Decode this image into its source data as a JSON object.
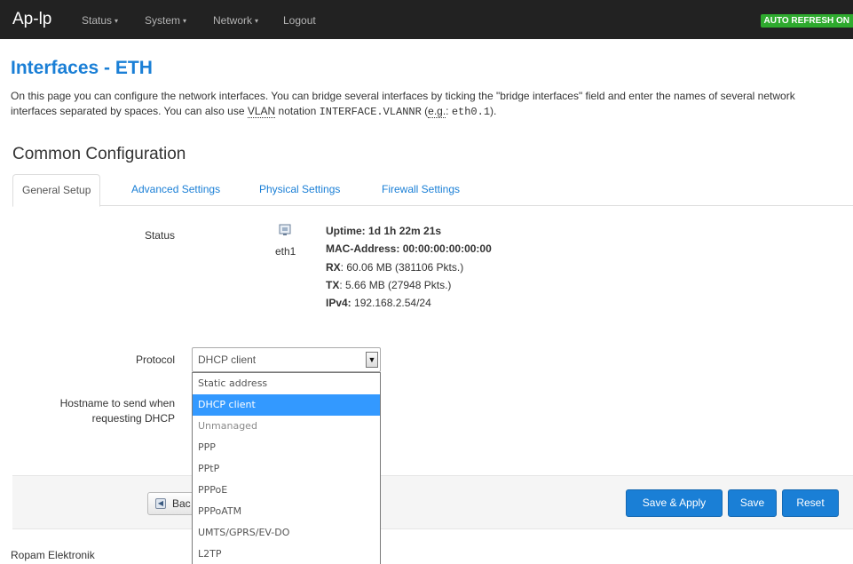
{
  "navbar": {
    "brand": "Ap-lp",
    "menu": [
      {
        "label": "Status",
        "caret": "▾"
      },
      {
        "label": "System",
        "caret": "▾"
      },
      {
        "label": "Network",
        "caret": "▾"
      },
      {
        "label": "Logout",
        "caret": ""
      }
    ],
    "auto_refresh": "AUTO REFRESH ON"
  },
  "page": {
    "title": "Interfaces - ETH",
    "desc_1": "On this page you can configure the network interfaces. You can bridge several interfaces by ticking the \"bridge interfaces\" field and enter the names of several network interfaces separated by spaces. You can also use ",
    "desc_vlan": "VLAN",
    "desc_2": " notation ",
    "desc_code1": "INTERFACE.VLANNR",
    "desc_3": " (",
    "desc_eg": "e.g.",
    "desc_4": ": ",
    "desc_code2": "eth0.1",
    "desc_5": ")."
  },
  "section": {
    "title": "Common Configuration",
    "tabs": [
      "General Setup",
      "Advanced Settings",
      "Physical Settings",
      "Firewall Settings"
    ],
    "active_tab": "General Setup"
  },
  "status": {
    "label": "Status",
    "device": "eth1",
    "icon": "network-port-icon",
    "uptime_label": "Uptime:",
    "uptime": "1d 1h 22m 21s",
    "mac_label": "MAC-Address:",
    "mac": "00:00:00:00:00:00",
    "rx_label": "RX",
    "rx": ": 60.06 MB (381106 Pkts.)",
    "tx_label": "TX",
    "tx": ": 5.66 MB (27948 Pkts.)",
    "ipv4_label": "IPv4:",
    "ipv4": "192.168.2.54/24"
  },
  "protocol": {
    "label": "Protocol",
    "value": "DHCP client",
    "options": [
      "Static address",
      "DHCP client",
      "Unmanaged",
      "PPP",
      "PPtP",
      "PPPoE",
      "PPPoATM",
      "UMTS/GPRS/EV-DO",
      "L2TP"
    ],
    "selected_index": 1,
    "dimmed_index": 2
  },
  "hostname": {
    "label_line1": "Hostname to send when",
    "label_line2": "requesting DHCP"
  },
  "actions": {
    "back": "Back",
    "back_visible": "Bac",
    "save_apply": "Save & Apply",
    "save": "Save",
    "reset": "Reset"
  },
  "footer": {
    "text": "Ropam Elektronik"
  },
  "colors": {
    "navbar": "#222222",
    "accent": "#1a7fd6",
    "auto_refresh": "#2eaa2e",
    "selected_option": "#3399ff"
  }
}
